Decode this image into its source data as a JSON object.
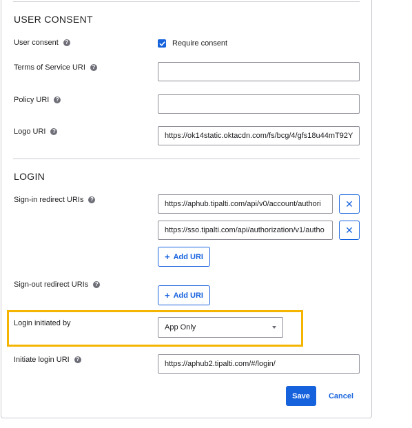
{
  "user_consent": {
    "section_title": "USER CONSENT",
    "user_consent_label": "User consent",
    "require_consent_label": "Require consent",
    "tos_label": "Terms of Service URI",
    "tos_value": "",
    "policy_label": "Policy URI",
    "policy_value": "",
    "logo_label": "Logo URI",
    "logo_value": "https://ok14static.oktacdn.com/fs/bcg/4/gfs18u44mT92Y"
  },
  "login": {
    "section_title": "LOGIN",
    "signin_label": "Sign-in redirect URIs",
    "signin_uris": [
      "https://aphub.tipalti.com/api/v0/account/authori",
      "https://sso.tipalti.com/api/authorization/v1/autho"
    ],
    "add_uri_label": "Add URI",
    "signout_label": "Sign-out redirect URIs",
    "login_initiated_label": "Login initiated by",
    "login_initiated_value": "App Only",
    "initiate_login_label": "Initiate login URI",
    "initiate_login_value": "https://aphub2.tipalti.com/#/login/"
  },
  "actions": {
    "save_label": "Save",
    "cancel_label": "Cancel"
  },
  "icons": {
    "help": "help-icon",
    "remove": "close-icon",
    "add": "plus-icon",
    "dropdown": "chevron-down-icon",
    "checkbox": "check-icon"
  },
  "colors": {
    "primary": "#1662dd",
    "highlight": "#f4b400",
    "border": "#c9c9d0"
  }
}
